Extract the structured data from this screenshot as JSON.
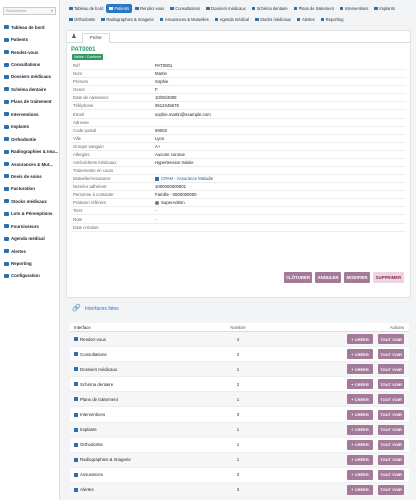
{
  "sidebar": {
    "search_placeholder": "Rechercher",
    "search_caret": "▾",
    "items": [
      {
        "label": "Tableau de bord"
      },
      {
        "label": "Patients"
      },
      {
        "label": "Rendez-vous"
      },
      {
        "label": "Consultations"
      },
      {
        "label": "Dossiers médicaux"
      },
      {
        "label": "Schéma dentaire"
      },
      {
        "label": "Plans de traitement"
      },
      {
        "label": "Interventions"
      },
      {
        "label": "Implants"
      },
      {
        "label": "Orthodontie"
      },
      {
        "label": "Radiographies & Ima..."
      },
      {
        "label": "Assurances & Mut..."
      },
      {
        "label": "Devis de soins"
      },
      {
        "label": "Facturation"
      },
      {
        "label": "Stocks médicaux"
      },
      {
        "label": "Lots & Péremptions"
      },
      {
        "label": "Fournisseurs"
      },
      {
        "label": "Agenda médical"
      },
      {
        "label": "Alertes"
      },
      {
        "label": "Reporting"
      },
      {
        "label": "Configuration"
      }
    ]
  },
  "topbar": {
    "row1": [
      "Tableau de bord",
      "Patients",
      "Rendez-vous",
      "Consultations",
      "Dossiers médicaux",
      "Schéma dentaire",
      "Plans de traitement",
      "Interventions",
      "Implants"
    ],
    "row2": [
      "Orthodontie",
      "Radiographies & Imagerie",
      "Assurances & Mutuelles",
      "Agenda médical",
      "Stocks médicaux",
      "Alertes",
      "Reporting"
    ],
    "active": "Patients"
  },
  "record": {
    "subtab": "Fiche",
    "ref": "PAT0001",
    "status": "Validé / Confirmé",
    "fields": [
      {
        "label": "Réf",
        "value": "PAT0001"
      },
      {
        "label": "Nom",
        "value": "Martin"
      },
      {
        "label": "Prénom",
        "value": "Sophie"
      },
      {
        "label": "Genre",
        "value": "F"
      },
      {
        "label": "Date de naissance",
        "value": "10/06/2008"
      },
      {
        "label": "Téléphone",
        "value": "0612345678"
      },
      {
        "label": "Email",
        "value": "sophie.martin@example.com"
      },
      {
        "label": "Adresse",
        "value": ""
      },
      {
        "label": "Code postal",
        "value": "69003"
      },
      {
        "label": "Ville",
        "value": "Lyon"
      },
      {
        "label": "Groupe sanguin",
        "value": "A+"
      },
      {
        "label": "Allergies",
        "value": "Aucune connue"
      },
      {
        "label": "Antécédents médicaux",
        "value": "Hypertension traitée"
      },
      {
        "label": "Traitements en cours",
        "value": ""
      },
      {
        "label": "Mutuelle/Assurance",
        "value": "CPAM - Assurance Maladie"
      },
      {
        "label": "Numéro adhérent",
        "value": "1000000000001"
      },
      {
        "label": "Personne à contacter",
        "value": "Famille - 0600000000"
      },
      {
        "label": "Praticien référent",
        "value": "SuperAdmin"
      },
      {
        "label": "Tiers",
        "value": "-"
      },
      {
        "label": "Note",
        "value": "-"
      },
      {
        "label": "Date création",
        "value": ""
      }
    ],
    "buttons": {
      "close": "CLÔTURER",
      "cancel": "ANNULER",
      "edit": "MODIFIER",
      "delete": "SUPPRIMER"
    }
  },
  "linked": {
    "title": "Interfaces liées",
    "headers": {
      "interface": "Interface",
      "count": "Nombre",
      "actions": "Actions"
    },
    "create_label": "+ CRÉER",
    "view_label": "TOUT VOIR",
    "rows": [
      {
        "name": "Rendez-vous",
        "count": "4"
      },
      {
        "name": "Consultations",
        "count": "2"
      },
      {
        "name": "Dossiers médicaux",
        "count": "1"
      },
      {
        "name": "Schéma dentaire",
        "count": "2"
      },
      {
        "name": "Plans de traitement",
        "count": "1"
      },
      {
        "name": "Interventions",
        "count": "3"
      },
      {
        "name": "Implants",
        "count": "1"
      },
      {
        "name": "Orthodontie",
        "count": "1"
      },
      {
        "name": "Radiographies & Imagerie",
        "count": "1"
      },
      {
        "name": "Assurances",
        "count": "3"
      },
      {
        "name": "Alertes",
        "count": "3"
      }
    ]
  }
}
